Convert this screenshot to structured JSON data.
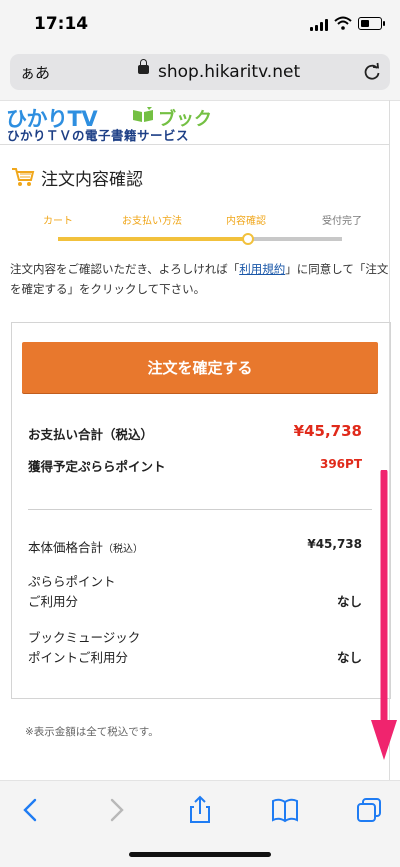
{
  "status": {
    "time": "17:14"
  },
  "browser": {
    "aa_label": "ぁあ",
    "url": "shop.hikaritv.net"
  },
  "brand": {
    "logo_main": "ひかりTV",
    "logo_book": "ブック",
    "logo_sub": "ひかりＴＶの電子書籍サービス"
  },
  "page": {
    "title": "注文内容確認"
  },
  "steps": [
    "カート",
    "お支払い方法",
    "内容確認",
    "受付完了"
  ],
  "steps_progress": 0.75,
  "description": {
    "pre": "注文内容をご確認いただき、よろしければ「",
    "link": "利用規約",
    "post": "」に同意して「注文を確定する」をクリックして下さい。"
  },
  "order": {
    "confirm_label": "注文を確定する",
    "total_label": "お支払い合計（税込）",
    "total_value": "¥45,738",
    "points_label": "獲得予定ぷららポイント",
    "points_value": "396PT",
    "subtotal_label": "本体価格合計",
    "subtotal_tax": "（税込）",
    "subtotal_value": "¥45,738",
    "plala_label_1": "ぷららポイント",
    "plala_label_2": "ご利用分",
    "plala_value": "なし",
    "music_label_1": "ブックミュージック",
    "music_label_2": "ポイントご利用分",
    "music_value": "なし"
  },
  "note": "※表示金額は全て税込です。",
  "colors": {
    "accent": "#e8782d",
    "price_red": "#e02a1a",
    "step_yellow": "#f2c13c",
    "arrow": "#f0246e"
  }
}
